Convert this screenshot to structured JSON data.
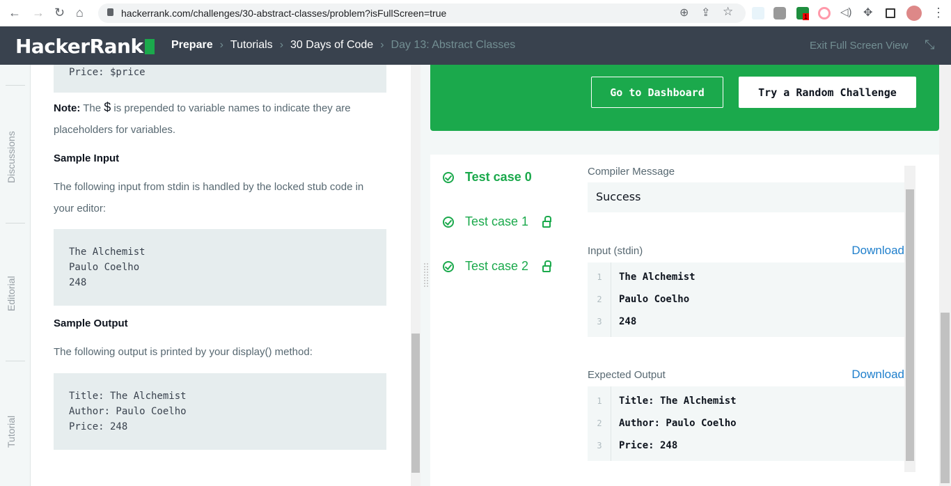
{
  "browser": {
    "url": "hackerrank.com/challenges/30-abstract-classes/problem?isFullScreen=true",
    "ext_badge": "1"
  },
  "header": {
    "logo": "HackerRank",
    "breadcrumbs": [
      "Prepare",
      "Tutorials",
      "30 Days of Code",
      "Day 13: Abstract Classes"
    ],
    "exit": "Exit Full Screen View"
  },
  "sidebar": {
    "tabs": [
      "Discussions",
      "Editorial",
      "Tutorial"
    ]
  },
  "problem": {
    "code_top": "Price: $price",
    "note_label": "Note:",
    "note_pre": "The ",
    "note_symbol": "$",
    "note_post": " is prepended to variable names to indicate they are placeholders for variables.",
    "sample_input_heading": "Sample Input",
    "sample_input_desc": "The following input from stdin is handled by the locked stub code in your editor:",
    "sample_input": "The Alchemist\nPaulo Coelho\n248",
    "sample_output_heading": "Sample Output",
    "sample_output_desc": "The following output is printed by your display() method:",
    "sample_output": "Title: The Alchemist\nAuthor: Paulo Coelho\nPrice: 248"
  },
  "actions": {
    "dashboard": "Go to Dashboard",
    "random": "Try a Random Challenge"
  },
  "results": {
    "test_cases": [
      {
        "label": "Test case 0",
        "locked": false
      },
      {
        "label": "Test case 1",
        "locked": true
      },
      {
        "label": "Test case 2",
        "locked": true
      }
    ],
    "compiler_label": "Compiler Message",
    "compiler_message": "Success",
    "input_label": "Input (stdin)",
    "download": "Download",
    "input_lines": [
      {
        "n": "1",
        "t": "The Alchemist"
      },
      {
        "n": "2",
        "t": "Paulo Coelho"
      },
      {
        "n": "3",
        "t": "248"
      }
    ],
    "expected_label": "Expected Output",
    "expected_lines": [
      {
        "n": "1",
        "t": "Title: The Alchemist"
      },
      {
        "n": "2",
        "t": "Author: Paulo Coelho"
      },
      {
        "n": "3",
        "t": "Price: 248"
      }
    ]
  }
}
